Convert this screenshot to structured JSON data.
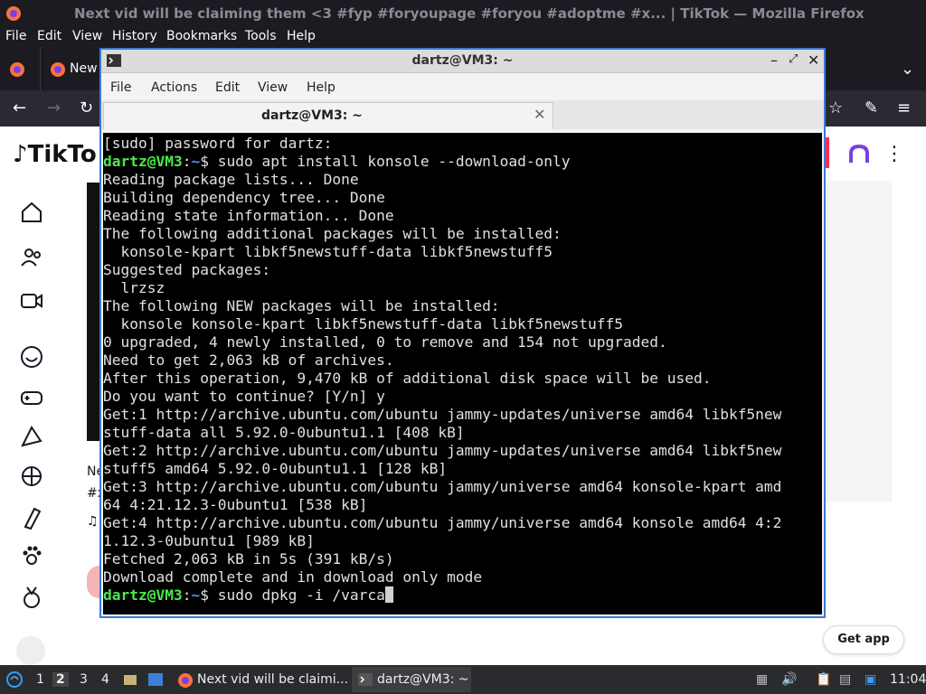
{
  "firefox": {
    "window_title": "Next vid will be claiming them <3 #fyp #foryoupage #foryou #adoptme #x... | TikTok — Mozilla Firefox",
    "menu": [
      "File",
      "Edit",
      "View",
      "History",
      "Bookmarks",
      "Tools",
      "Help"
    ],
    "tab_label": "New",
    "tiktok_logo_text": "TikTo",
    "partial_text_1": "Ne",
    "partial_text_2": "#x",
    "get_app_button": "Get app"
  },
  "terminal": {
    "title": "dartz@VM3: ~",
    "menu": [
      "File",
      "Actions",
      "Edit",
      "View",
      "Help"
    ],
    "tab_title": "dartz@VM3: ~",
    "prompt_user": "dartz@VM3",
    "prompt_sep": ":",
    "prompt_path": "~",
    "prompt_symbol": "$",
    "lines": [
      {
        "type": "text",
        "text": "[sudo] password for dartz:"
      },
      {
        "type": "prompt",
        "command": " sudo apt install konsole --download-only"
      },
      {
        "type": "text",
        "text": "Reading package lists... Done"
      },
      {
        "type": "text",
        "text": "Building dependency tree... Done"
      },
      {
        "type": "text",
        "text": "Reading state information... Done"
      },
      {
        "type": "text",
        "text": "The following additional packages will be installed:"
      },
      {
        "type": "text",
        "text": "  konsole-kpart libkf5newstuff-data libkf5newstuff5"
      },
      {
        "type": "text",
        "text": "Suggested packages:"
      },
      {
        "type": "text",
        "text": "  lrzsz"
      },
      {
        "type": "text",
        "text": "The following NEW packages will be installed:"
      },
      {
        "type": "text",
        "text": "  konsole konsole-kpart libkf5newstuff-data libkf5newstuff5"
      },
      {
        "type": "text",
        "text": "0 upgraded, 4 newly installed, 0 to remove and 154 not upgraded."
      },
      {
        "type": "text",
        "text": "Need to get 2,063 kB of archives."
      },
      {
        "type": "text",
        "text": "After this operation, 9,470 kB of additional disk space will be used."
      },
      {
        "type": "text",
        "text": "Do you want to continue? [Y/n] y"
      },
      {
        "type": "text",
        "text": "Get:1 http://archive.ubuntu.com/ubuntu jammy-updates/universe amd64 libkf5new"
      },
      {
        "type": "text",
        "text": "stuff-data all 5.92.0-0ubuntu1.1 [408 kB]"
      },
      {
        "type": "text",
        "text": "Get:2 http://archive.ubuntu.com/ubuntu jammy-updates/universe amd64 libkf5new"
      },
      {
        "type": "text",
        "text": "stuff5 amd64 5.92.0-0ubuntu1.1 [128 kB]"
      },
      {
        "type": "text",
        "text": "Get:3 http://archive.ubuntu.com/ubuntu jammy/universe amd64 konsole-kpart amd"
      },
      {
        "type": "text",
        "text": "64 4:21.12.3-0ubuntu1 [538 kB]"
      },
      {
        "type": "text",
        "text": "Get:4 http://archive.ubuntu.com/ubuntu jammy/universe amd64 konsole amd64 4:2"
      },
      {
        "type": "text",
        "text": "1.12.3-0ubuntu1 [989 kB]"
      },
      {
        "type": "text",
        "text": "Fetched 2,063 kB in 5s (391 kB/s)"
      },
      {
        "type": "text",
        "text": "Download complete and in download only mode"
      },
      {
        "type": "prompt",
        "command": " sudo dpkg -i /varca",
        "cursor": true
      }
    ]
  },
  "taskbar": {
    "workspaces": [
      "1",
      "2",
      "3",
      "4"
    ],
    "active_workspace": "2",
    "firefox_task": "Next vid will be claimi...",
    "terminal_task": "dartz@VM3: ~",
    "clock": "11:04"
  },
  "colors": {
    "prompt_user": "#4ce94c",
    "prompt_path": "#5a8cff",
    "terminal_bg": "#000000",
    "window_border": "#3a7bd5"
  }
}
